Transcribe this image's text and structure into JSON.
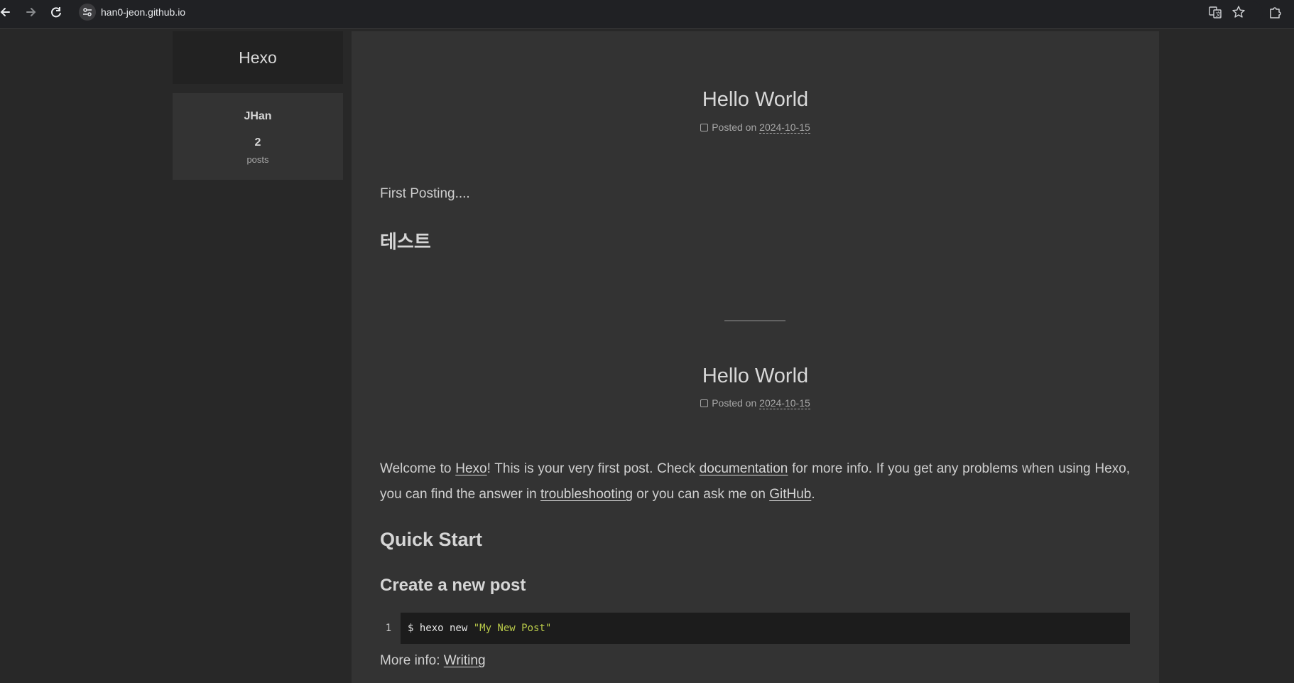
{
  "browser": {
    "url": "han0-jeon.github.io"
  },
  "sidebar": {
    "site_title": "Hexo",
    "author": "JHan",
    "post_count": "2",
    "post_count_label": "posts"
  },
  "posts": [
    {
      "title": "Hello World",
      "posted_on_label": "Posted on",
      "date": "2024-10-15",
      "paragraph": "First Posting....",
      "heading": "테스트"
    },
    {
      "title": "Hello World",
      "posted_on_label": "Posted on",
      "date": "2024-10-15",
      "intro": {
        "t1": "Welcome to ",
        "link1": "Hexo",
        "t2": "! This is your very first post. Check ",
        "link2": "documentation",
        "t3": " for more info. If you get any problems when using Hexo, you can find the answer in ",
        "link3": "troubleshooting",
        "t4": " or you can ask me on ",
        "link4": "GitHub",
        "t5": "."
      },
      "heading_quick_start": "Quick Start",
      "heading_create_post": "Create a new post",
      "code": {
        "line_number": "1",
        "command": "$ hexo new ",
        "argument": "\"My New Post\""
      },
      "more_info": {
        "label": "More info: ",
        "link": "Writing"
      }
    }
  ]
}
